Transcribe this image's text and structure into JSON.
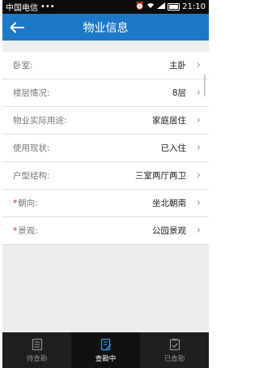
{
  "status": {
    "carrier": "中国电信",
    "dots": "•••",
    "time": "21:10"
  },
  "header": {
    "back_icon": "arrow-left-icon",
    "title": "物业信息"
  },
  "rows": [
    {
      "label": "卧室:",
      "value": "主卧",
      "required": false
    },
    {
      "label": "楼层情况:",
      "value": "8层",
      "required": false
    },
    {
      "label": "物业实际用途:",
      "value": "家庭居住",
      "required": false
    },
    {
      "label": "使用现状:",
      "value": "已入住",
      "required": false
    },
    {
      "label": "户型结构:",
      "value": "三室两厅两卫",
      "required": false
    },
    {
      "label": "朝向:",
      "value": "坐北朝南",
      "required": true
    },
    {
      "label": "景观:",
      "value": "公园景观",
      "required": true
    }
  ],
  "tabs": [
    {
      "label": "待查勘",
      "icon": "list-icon",
      "active": false
    },
    {
      "label": "查勘中",
      "icon": "edit-document-icon",
      "active": true
    },
    {
      "label": "已查勘",
      "icon": "checked-document-icon",
      "active": false
    }
  ],
  "colors": {
    "header": "#1e78c8",
    "required_mark": "#e02020",
    "tabbar": "#1f1f1f"
  }
}
